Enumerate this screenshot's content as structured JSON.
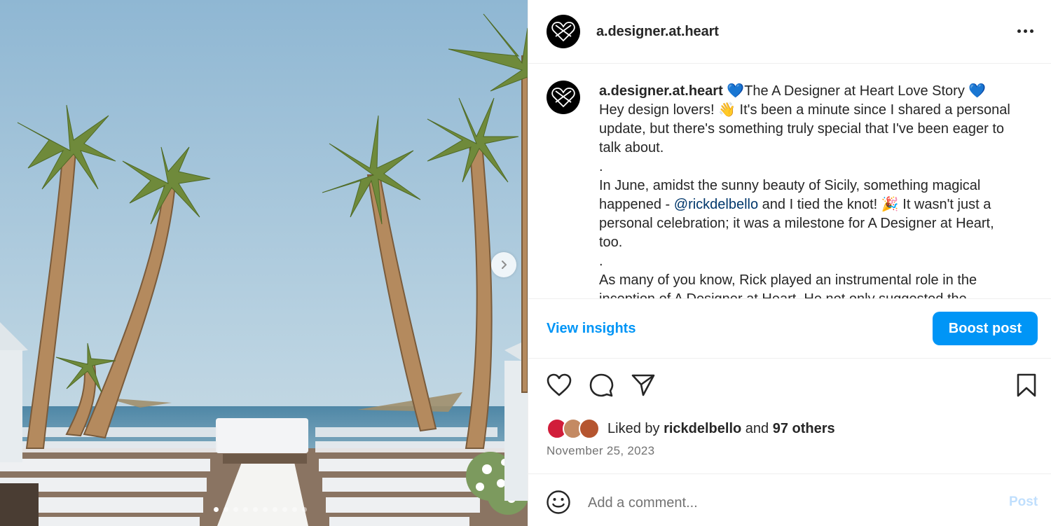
{
  "carousel": {
    "total_slides": 10,
    "active_slide": 1,
    "next_icon": "chevron-right-icon"
  },
  "header": {
    "username": "a.designer.at.heart",
    "avatar_icon": "heart-logo-icon",
    "more_icon": "more-horizontal-icon"
  },
  "caption": {
    "username": "a.designer.at.heart",
    "title": "The A Designer at Heart Love Story",
    "title_emoji": "💙",
    "line1": "Hey design lovers! 👋 It's been a minute since I shared a personal update, but there's something truly special that I've been eager to talk about.",
    "separator1": ".",
    "line2_before": "In June, amidst the sunny beauty of Sicily, something magical happened - ",
    "mention": "@rickdelbello",
    "line2_after": " and I tied the knot! 🎉 It wasn't just a personal celebration; it was a milestone for A Designer at Heart, too.",
    "separator2": ".",
    "line3": "As many of you know, Rick played an instrumental role in the inception of A Designer at Heart. He not only suggested the"
  },
  "insights": {
    "view_label": "View insights",
    "boost_label": "Boost post"
  },
  "actions": {
    "like_icon": "heart-icon",
    "comment_icon": "comment-icon",
    "share_icon": "share-icon",
    "save_icon": "bookmark-icon"
  },
  "likes": {
    "prefix": "Liked by",
    "user": "rickdelbello",
    "connector": "and",
    "others": "97 others"
  },
  "date": "November 25, 2023",
  "comment": {
    "placeholder": "Add a comment...",
    "post_label": "Post",
    "emoji_icon": "smiley-icon"
  },
  "colors": {
    "accent": "#0095f6",
    "mention": "#00376b",
    "post_disabled": "#c0dffd"
  }
}
